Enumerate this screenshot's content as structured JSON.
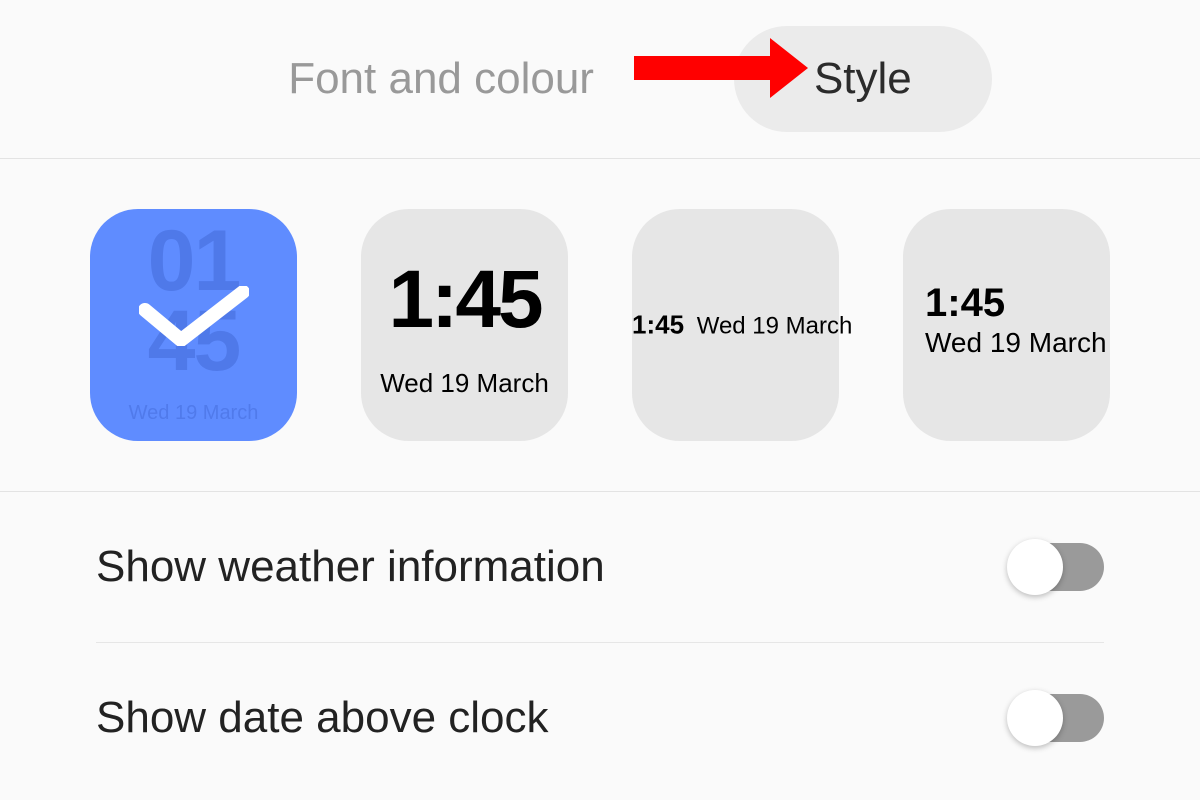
{
  "tabs": {
    "font_colour": "Font and colour",
    "style": "Style"
  },
  "styles": {
    "sample_time_compact": "1:45",
    "sample_date": "Wed 19 March",
    "sample_top": "01",
    "sample_bot": "45"
  },
  "settings": {
    "show_weather": {
      "label": "Show weather information",
      "value": false
    },
    "show_date_above": {
      "label": "Show date above clock",
      "value": false
    }
  }
}
